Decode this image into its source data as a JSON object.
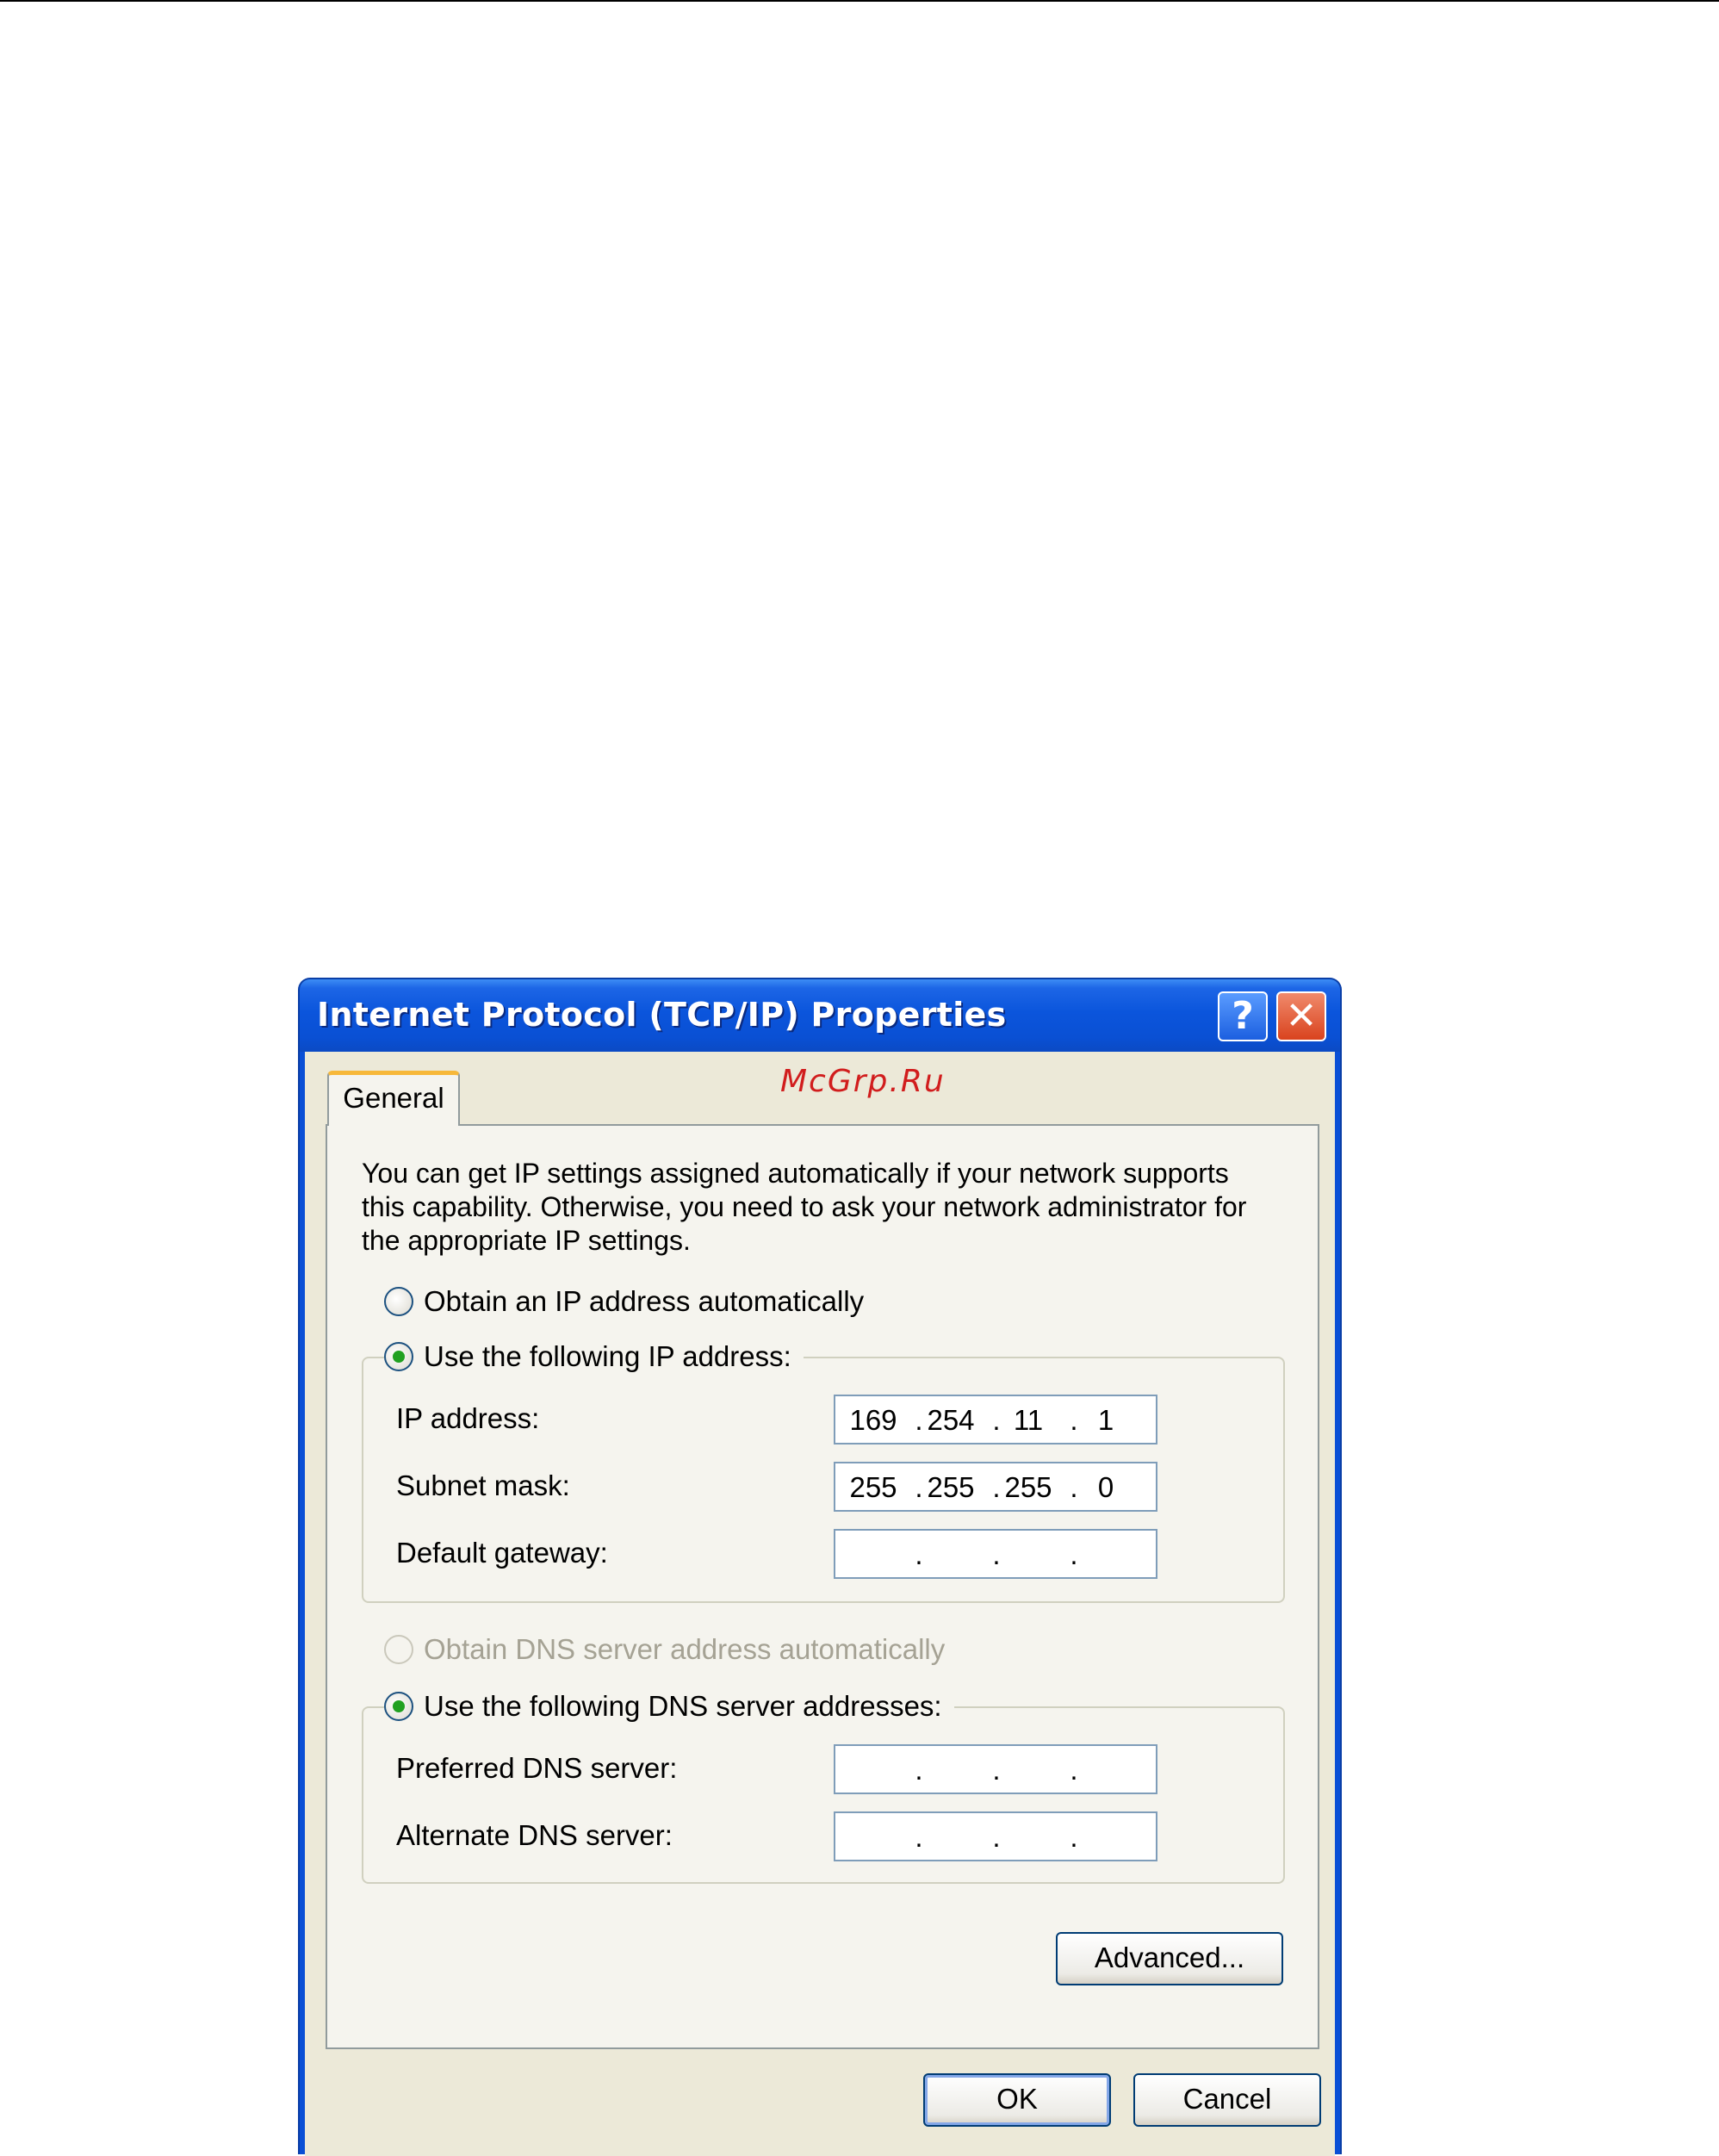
{
  "window": {
    "title": "Internet Protocol (TCP/IP) Properties",
    "help_label": "?",
    "close_label": "✕"
  },
  "watermark": "McGrp.Ru",
  "tabs": [
    {
      "label": "General",
      "active": true
    }
  ],
  "description": [
    "You can get IP settings assigned automatically if your network supports",
    "this capability. Otherwise, you need to ask your network administrator for",
    "the appropriate IP settings."
  ],
  "ip_section": {
    "auto_label": "Obtain an IP address automatically",
    "auto_checked": false,
    "manual_label": "Use the following IP address:",
    "manual_checked": true,
    "fields": [
      {
        "label": "IP address:",
        "octets": [
          "169",
          "254",
          "11",
          "1"
        ]
      },
      {
        "label": "Subnet mask:",
        "octets": [
          "255",
          "255",
          "255",
          "0"
        ]
      },
      {
        "label": "Default gateway:",
        "octets": [
          "",
          "",
          "",
          ""
        ]
      }
    ]
  },
  "dns_section": {
    "auto_label": "Obtain DNS server address automatically",
    "auto_checked": false,
    "auto_disabled": true,
    "manual_label": "Use the following DNS server addresses:",
    "manual_checked": true,
    "fields": [
      {
        "label": "Preferred DNS server:",
        "octets": [
          "",
          "",
          "",
          ""
        ]
      },
      {
        "label": "Alternate DNS server:",
        "octets": [
          "",
          "",
          "",
          ""
        ]
      }
    ]
  },
  "buttons": {
    "advanced": "Advanced...",
    "ok": "OK",
    "cancel": "Cancel"
  },
  "colors": {
    "title_bar": "#0a50d4",
    "dialog_face": "#ece9d8",
    "tab_highlight": "#f7b83a",
    "radio_dot": "#21a121",
    "watermark": "#d11d1d"
  }
}
